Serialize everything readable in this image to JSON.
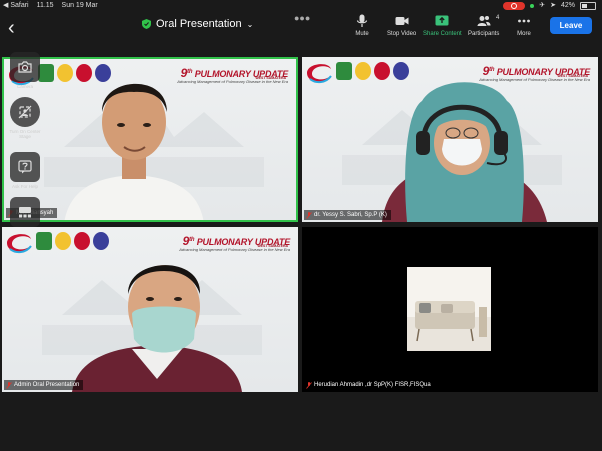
{
  "status_bar": {
    "app": "Safari",
    "time": "11.15",
    "date": "Sun 19 Mar",
    "battery": "42%"
  },
  "meeting": {
    "title": "Oral Presentation"
  },
  "toolbar": {
    "mute": "Mute",
    "stop_video": "Stop Video",
    "share_content": "Share Content",
    "participants": "Participants",
    "participant_count": "4",
    "more": "More",
    "leave": "Leave"
  },
  "side_controls": {
    "camera": "Camera",
    "turn_on_center_stage": "Turn On Center Stage",
    "ask_for_help": "Ask For Help"
  },
  "tiles": [
    {
      "name": "Mu...diansyah",
      "banner": {
        "number": "9",
        "ordinal": "th",
        "title": "PULMONARY UPDATE",
        "sub": "WEST SUMATERA",
        "tagline": "Advancing Management of Pulmonary Disease in the New Era"
      }
    },
    {
      "name": "dr. Yessy S. Sabri, Sp.P (K)",
      "banner": {
        "number": "9",
        "ordinal": "th",
        "title": "PULMONARY UPDATE",
        "sub": "WEST SUMATERA",
        "tagline": "Advancing Management of Pulmonary Disease in the New Era"
      }
    },
    {
      "name": "Admin Oral Presentation",
      "banner": {
        "number": "9",
        "ordinal": "th",
        "title": "PULMONARY UPDATE",
        "sub": "WEST SUMATERA",
        "tagline": "Advancing Management of Pulmonary Disease in the New Era"
      }
    },
    {
      "name": "Herudian Ahmadin ,dr SpP(K) FISR,FISQua"
    }
  ],
  "colors": {
    "active_border": "#31c24a",
    "leave": "#1a73e8",
    "share": "#3ac27a",
    "muted": "#e0342b",
    "banner_red": "#b3142a"
  }
}
